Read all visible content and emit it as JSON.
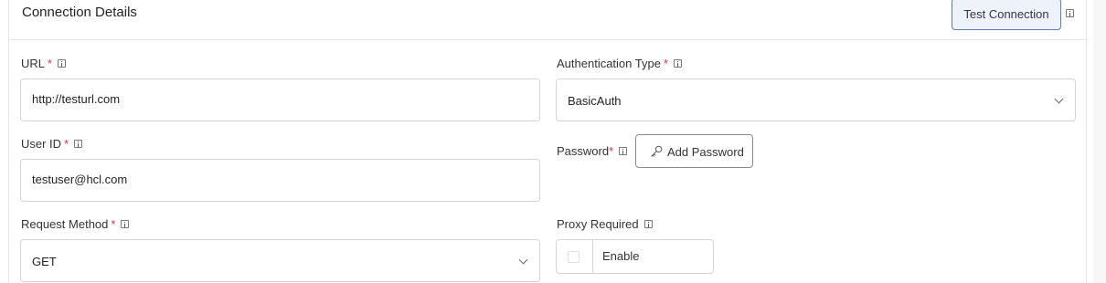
{
  "header": {
    "title": "Connection Details",
    "test_button_label": "Test Connection"
  },
  "url": {
    "label": "URL",
    "required_mark": "*",
    "value": "http://testurl.com"
  },
  "auth_type": {
    "label": "Authentication Type",
    "required_mark": "*",
    "selected": "BasicAuth"
  },
  "user_id": {
    "label": "User ID",
    "required_mark": "*",
    "value": "testuser@hcl.com"
  },
  "password": {
    "label": "Password",
    "required_mark": "*",
    "button_label": "Add Password"
  },
  "request_method": {
    "label": "Request Method",
    "required_mark": "*",
    "selected": "GET"
  },
  "proxy": {
    "label": "Proxy Required",
    "option_label": "Enable",
    "checked": false
  },
  "colors": {
    "required": "#d63a3a",
    "border": "#d4d4d4",
    "test_button_border": "#5b7fb4",
    "test_button_bg": "#eef3fb"
  }
}
